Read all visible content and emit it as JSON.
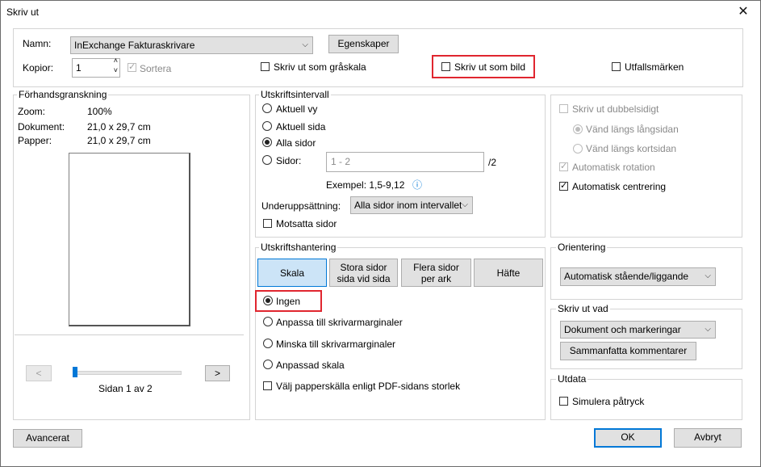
{
  "window": {
    "title": "Skriv ut",
    "close_glyph": "✕"
  },
  "printer": {
    "name_label": "Namn:",
    "name_value": "InExchange Fakturaskrivare",
    "properties_button": "Egenskaper",
    "copies_label": "Kopior:",
    "copies_value": "1",
    "collate_label": "Sortera",
    "grayscale_label": "Skriv ut som gråskala",
    "as_image_label": "Skriv ut som bild",
    "bleed_marks_label": "Utfallsmärken"
  },
  "preview": {
    "title": "Förhandsgranskning",
    "zoom_label": "Zoom:",
    "zoom_value": "100%",
    "document_label": "Dokument:",
    "document_value": "21,0 x 29,7 cm",
    "paper_label": "Papper:",
    "paper_value": "21,0 x 29,7 cm",
    "prev_glyph": "<",
    "next_glyph": ">",
    "page_text": "Sidan 1 av 2"
  },
  "range": {
    "title": "Utskriftsintervall",
    "current_view": "Aktuell vy",
    "current_page": "Aktuell sida",
    "all_pages": "Alla sidor",
    "pages_label": "Sidor:",
    "pages_placeholder": "1 - 2",
    "pages_total": "/2",
    "example": "Exempel: 1,5-9,12",
    "info_glyph": "ⓘ",
    "subset_label": "Underuppsättning:",
    "subset_value": "Alla sidor inom intervallet",
    "reverse_label": "Motsatta sidor"
  },
  "duplex": {
    "print_duplex": "Skriv ut dubbelsidigt",
    "long_edge": "Vänd längs långsidan",
    "short_edge": "Vänd längs kortsidan",
    "auto_rotate": "Automatisk rotation",
    "auto_center": "Automatisk centrering"
  },
  "handling": {
    "title": "Utskriftshantering",
    "tabs": [
      "Skala",
      "Stora sidor\nsida vid sida",
      "Flera sidor\nper ark",
      "Häfte"
    ],
    "none": "Ingen",
    "fit": "Anpassa till skrivarmarginaler",
    "shrink": "Minska till skrivarmarginaler",
    "custom": "Anpassad skala",
    "paper_source": "Välj papperskälla enligt PDF-sidans storlek"
  },
  "orientation": {
    "title": "Orientering",
    "value": "Automatisk stående/liggande"
  },
  "print_what": {
    "title": "Skriv ut vad",
    "value": "Dokument och markeringar",
    "summarize_button": "Sammanfatta kommentarer"
  },
  "output": {
    "title": "Utdata",
    "simulate_overprint": "Simulera påtryck"
  },
  "footer": {
    "advanced": "Avancerat",
    "ok": "OK",
    "cancel": "Avbryt"
  },
  "colors": {
    "accent": "#0078d7",
    "highlight": "#e0262f",
    "selected_tab": "#cce4f7"
  }
}
